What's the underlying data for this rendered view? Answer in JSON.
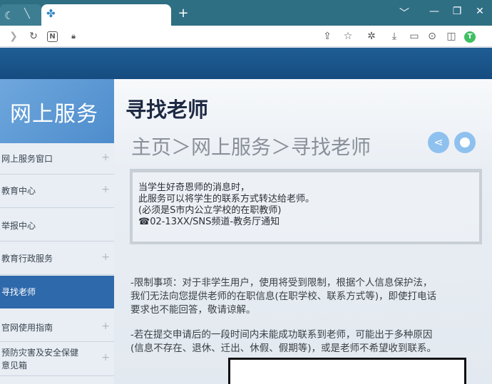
{
  "browser": {
    "newtab_symbol": "+",
    "window_controls": [
      "﹀",
      "—",
      "❐",
      "✕"
    ]
  },
  "sidebar": {
    "title": "网上服务",
    "items": [
      {
        "label": "网上服务窗口",
        "plus": "+"
      },
      {
        "label": "教育中心",
        "plus": "+"
      },
      {
        "label": "举报中心",
        "plus": ""
      },
      {
        "label": "教育行政服务",
        "plus": "+"
      },
      {
        "label": "寻找老师",
        "plus": ""
      },
      {
        "label": "官网使用指南",
        "plus": "+"
      },
      {
        "label": "预防灾害及安全保健",
        "label2": "意见箱",
        "plus": "+"
      }
    ]
  },
  "main": {
    "title": "寻找老师",
    "breadcrumb": "主页＞网上服务＞寻找老师",
    "notice": {
      "line1": "当学生好奇恩师的消息时，",
      "line2": "此服务可以将学生的联系方式转达给老师。",
      "line3": "(必须是S市内公立学校的在职教师)",
      "line4": "☎02-13XX/SNS频道-教务厅通知"
    },
    "para1": {
      "line1": "-限制事项：对于非学生用户，使用将受到限制，根据个人信息保护法，",
      "line2": "我们无法向您提供老师的在职信息(在职学校、联系方式等)，即使打电话",
      "line3": "要求也不能回答，敬请谅解。"
    },
    "para2": {
      "line1": "-若在提交申请后的一段时间内未能成功联系到老师，可能出于多种原因",
      "line2": "(信息不存在、退休、迁出、休假、假期等)，或是老师不希望收到联系。"
    }
  },
  "colors": {
    "header": "#1e5d94",
    "sidebar_active": "#2e69ab",
    "sidebar_head": "#5e9bd6",
    "share_button": "#8fc1ef"
  },
  "avatar_letter": "T"
}
